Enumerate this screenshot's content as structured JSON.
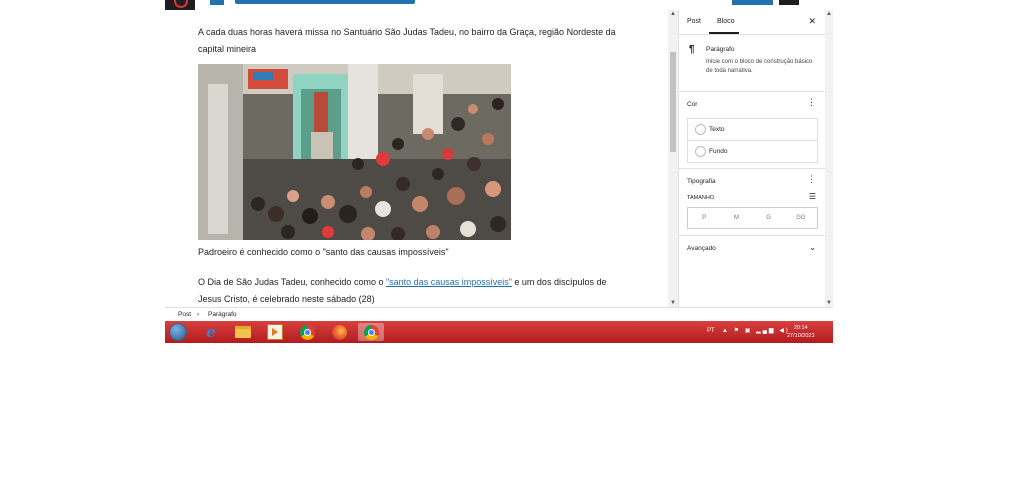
{
  "editor": {
    "paragraph1": "A cada duas horas haverá missa no Santuário São Judas Tadeu, no bairro da Graça, região Nordeste da capital mineira",
    "caption": "Padroeiro é conhecido como o \"santo das causas impossíveis\"",
    "paragraph2_before": "O Dia de São Judas Tadeu, conhecido como o ",
    "paragraph2_link": "\"santo das causas impossíveis\"",
    "paragraph2_after": " e um dos discípulos de Jesus Cristo, é celebrado neste sábado (28)"
  },
  "sidebar": {
    "tab_post": "Post",
    "tab_block": "Bloco",
    "close_icon": "close-icon",
    "block_name": "Parágrafo",
    "block_description": "Inicie com o bloco de construção básico de toda narrativa.",
    "color_section": "Cor",
    "color_text": "Texto",
    "color_background": "Fundo",
    "typography_section": "Tipografia",
    "size_label": "TAMANHO",
    "sizes": [
      "P",
      "M",
      "G",
      "GG"
    ],
    "advanced_section": "Avançado"
  },
  "breadcrumb": {
    "root": "Post",
    "current": "Parágrafo"
  },
  "taskbar": {
    "language": "PT",
    "time": "20:14",
    "date": "27/10/2023"
  },
  "colors": {
    "accent": "#2271b1",
    "taskbar": "#c62828"
  }
}
